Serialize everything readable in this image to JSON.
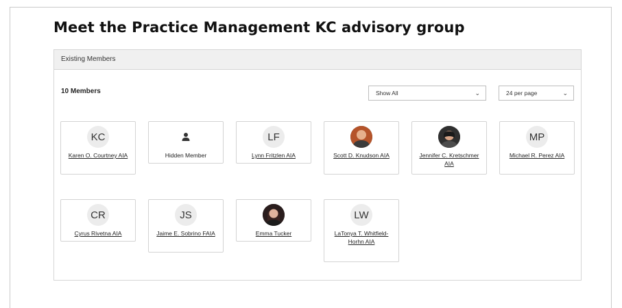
{
  "title": "Meet the Practice Management KC advisory group",
  "panel": {
    "header": "Existing Members",
    "count": "10 Members",
    "filter": {
      "selected": "Show All"
    },
    "per_page": {
      "selected": "24 per page"
    }
  },
  "members": [
    {
      "initials": "KC",
      "name": "Karen O. Courtney AIA",
      "avatar": "initials",
      "link": true
    },
    {
      "initials": "",
      "name": "Hidden Member",
      "avatar": "user-icon",
      "link": false
    },
    {
      "initials": "LF",
      "name": "Lynn Fritzlen AIA",
      "avatar": "initials",
      "link": true
    },
    {
      "initials": "",
      "name": "Scott D. Knudson AIA",
      "avatar": "photo",
      "link": true,
      "photo_color": "#b5542a"
    },
    {
      "initials": "",
      "name": "Jennifer C. Kretschmer AIA",
      "avatar": "photo",
      "link": true,
      "photo_color": "#2f2f2f"
    },
    {
      "initials": "MP",
      "name": "Michael R. Perez AIA",
      "avatar": "initials",
      "link": true
    },
    {
      "initials": "CR",
      "name": "Cyrus Rivetna AIA",
      "avatar": "initials",
      "link": true
    },
    {
      "initials": "JS",
      "name": "Jaime E. Sobrino FAIA",
      "avatar": "initials",
      "link": true
    },
    {
      "initials": "",
      "name": "Emma Tucker",
      "avatar": "photo",
      "link": true,
      "photo_color": "#2a1d1d"
    },
    {
      "initials": "LW",
      "name": "LaTonya T. Whitfield-Horhn AIA",
      "avatar": "initials",
      "link": true
    }
  ]
}
